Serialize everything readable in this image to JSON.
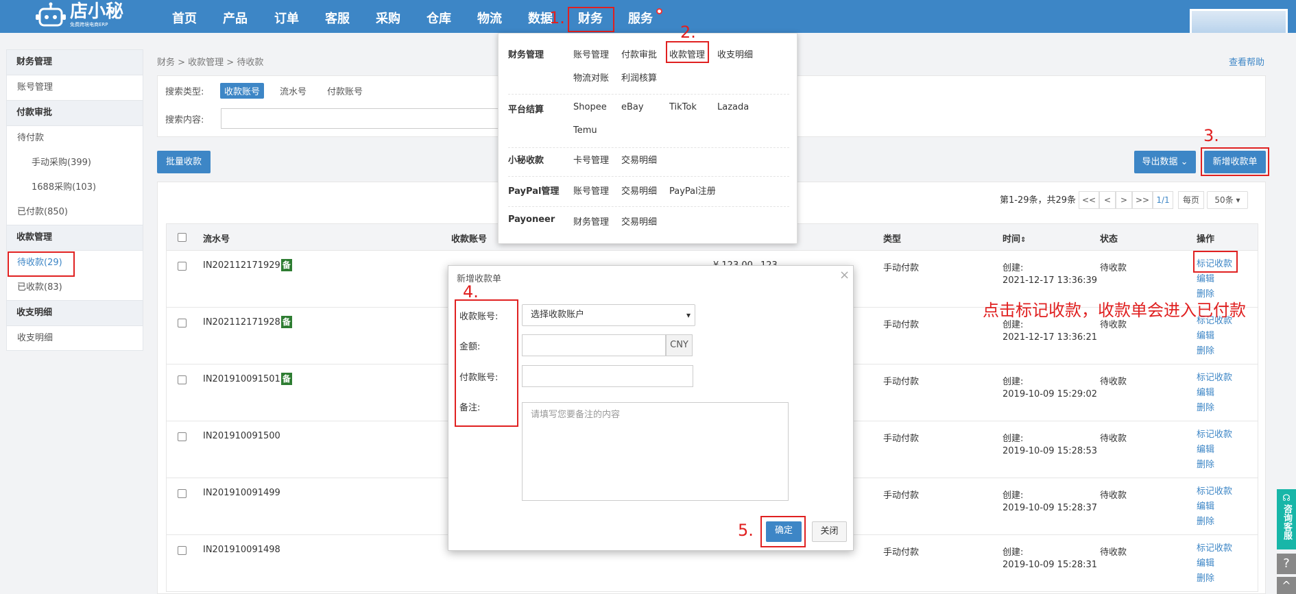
{
  "brand": {
    "name": "店小秘",
    "tagline": "免费跨境电商ERP"
  },
  "nav": [
    "首页",
    "产品",
    "订单",
    "客服",
    "采购",
    "仓库",
    "物流",
    "数据",
    "财务",
    "服务"
  ],
  "steps": [
    "1.",
    "2.",
    "3.",
    "4.",
    "5."
  ],
  "note": "点击标记收款，收款单会进入已付款",
  "sidebar": {
    "items": [
      "财务管理",
      "账号管理",
      "付款审批",
      "待付款",
      "手动采购(399)",
      "1688采购(103)",
      "已付款(850)",
      "收款管理",
      "待收款(29)",
      "已收款(83)",
      "收支明细",
      "收支明细"
    ]
  },
  "breadcrumb": "财务 > 收款管理 > 待收款",
  "help": "查看帮助",
  "search": {
    "type_label": "搜索类型:",
    "types": [
      "收款账号",
      "流水号",
      "付款账号"
    ],
    "content_label": "搜索内容:"
  },
  "toolbar": {
    "batch": "批量收款",
    "export": "导出数据 ⌄",
    "new": "新增收款单"
  },
  "pager": {
    "summary": "第1-29条，共29条",
    "first": "<<",
    "prev": "<",
    "next": ">",
    "last": ">>",
    "page": "1/1",
    "per_label": "每页",
    "per_value": "50条"
  },
  "table": {
    "headers": [
      "流水号",
      "收款账号",
      "类型",
      "时间",
      "状态",
      "操作"
    ],
    "bei": "备",
    "amount": "¥ 123.00",
    "account_val": "123",
    "rows": [
      {
        "id": "IN202112171929",
        "type": "手动付款",
        "created": "创建:",
        "time": "2021-12-17 13:36:39",
        "status": "待收款"
      },
      {
        "id": "IN202112171928",
        "type": "手动付款",
        "created": "创建:",
        "time": "2021-12-17 13:36:21",
        "status": "待收款"
      },
      {
        "id": "IN201910091501",
        "type": "手动付款",
        "created": "创建:",
        "time": "2019-10-09 15:29:02",
        "status": "待收款"
      },
      {
        "id": "IN201910091500",
        "type": "手动付款",
        "created": "创建:",
        "time": "2019-10-09 15:28:53",
        "status": "待收款"
      },
      {
        "id": "IN201910091499",
        "type": "手动付款",
        "created": "创建:",
        "time": "2019-10-09 15:28:37",
        "status": "待收款"
      },
      {
        "id": "IN201910091498",
        "type": "手动付款",
        "created": "创建:",
        "time": "2019-10-09 15:28:31",
        "status": "待收款"
      }
    ],
    "ops": [
      "标记收款",
      "编辑",
      "删除"
    ]
  },
  "dropdown": {
    "groups": [
      {
        "name": "财务管理",
        "links": [
          "账号管理",
          "付款审批",
          "收款管理",
          "收支明细",
          "物流对账",
          "利润核算"
        ]
      },
      {
        "name": "平台结算",
        "links": [
          "Shopee",
          "eBay",
          "TikTok",
          "Lazada",
          "Temu"
        ]
      },
      {
        "name": "小秘收款",
        "links": [
          "卡号管理",
          "交易明细"
        ]
      },
      {
        "name": "PayPal管理",
        "links": [
          "账号管理",
          "交易明细",
          "PayPal注册"
        ]
      },
      {
        "name": "Payoneer",
        "links": [
          "财务管理",
          "交易明细"
        ]
      }
    ]
  },
  "modal": {
    "title": "新增收款单",
    "close": "×",
    "account_label": "收款账号:",
    "account_value": "选择收款账户",
    "amount_label": "金额:",
    "currency": "CNY",
    "payer_label": "付款账号:",
    "remark_label": "备注:",
    "remark_placeholder": "请填写您要备注的内容",
    "confirm": "确定",
    "cancel": "关闭"
  },
  "floating": {
    "service": "咨询客服",
    "help": "?",
    "top": "^"
  }
}
